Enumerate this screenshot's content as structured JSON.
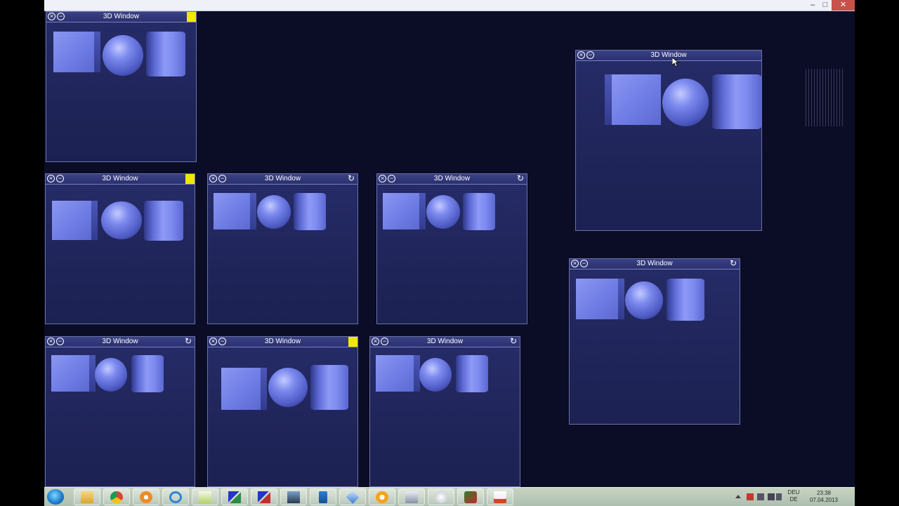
{
  "window_title": "",
  "caption_buttons": {
    "minimize": "–",
    "maximize": "□",
    "close": "✕"
  },
  "window_buttons": {
    "close": "×",
    "minimize": "−",
    "reset": "↻"
  },
  "windows3d": [
    {
      "title": "3D Window",
      "corner": "yellow"
    },
    {
      "title": "3D Window",
      "corner": "yellow"
    },
    {
      "title": "3D Window",
      "corner": "reset"
    },
    {
      "title": "3D Window",
      "corner": "reset"
    },
    {
      "title": "3D Window",
      "corner": "none"
    },
    {
      "title": "3D Window",
      "corner": "reset"
    },
    {
      "title": "3D Window",
      "corner": "reset"
    },
    {
      "title": "3D Window",
      "corner": "yellow"
    },
    {
      "title": "3D Window",
      "corner": "reset"
    }
  ],
  "taskbar": {
    "apps": [
      "file-explorer-icon",
      "chrome-icon",
      "media-player-icon",
      "internet-explorer-icon",
      "notepad-icon",
      "network-tool-icon",
      "network-tool-2-icon",
      "photo-viewer-icon",
      "usb-key-icon",
      "cube-app-icon",
      "vlc-icon",
      "screen-recorder-icon",
      "shield-icon",
      "game-icon",
      "java-icon"
    ],
    "tray": {
      "language_top": "DEU",
      "language_bottom": "DE",
      "time": "23:38",
      "date": "07.04.2013"
    }
  },
  "colors": {
    "background": "#0b0c26",
    "window_body": "#20255a",
    "shape_blue": "#7380ea",
    "accent_yellow": "#f1e800",
    "close_red": "#c7514b"
  }
}
